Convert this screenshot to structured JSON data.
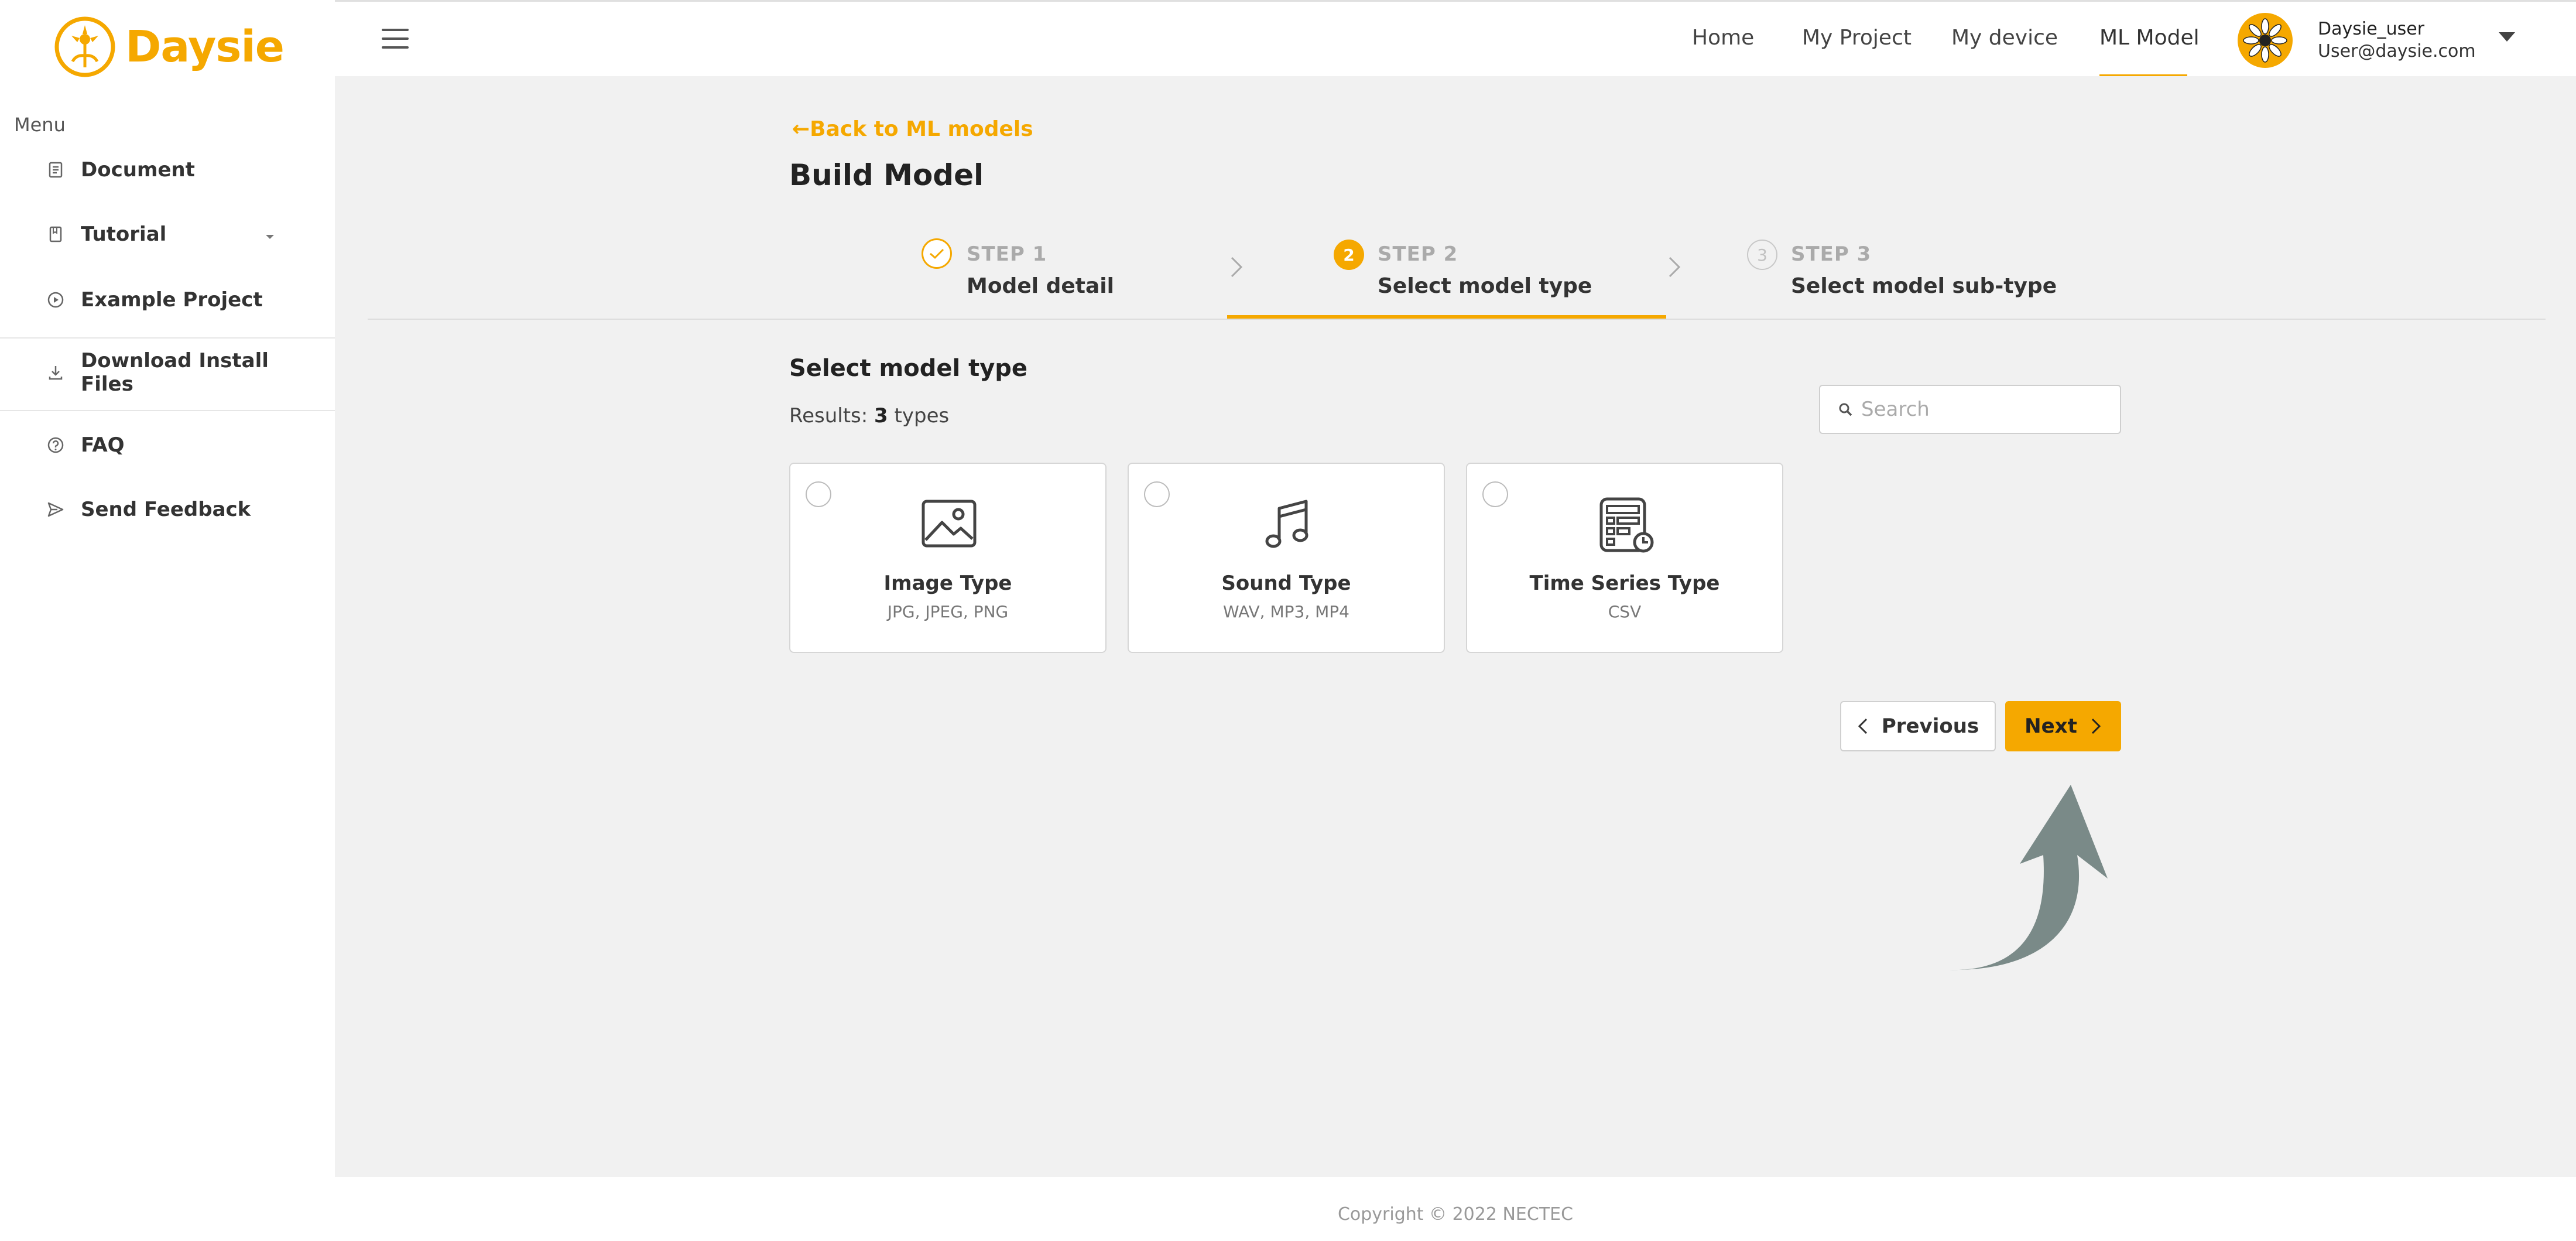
{
  "brand": {
    "name": "Daysie",
    "color": "#f5a800"
  },
  "sidebar": {
    "menu_label": "Menu",
    "items": [
      {
        "label": "Document",
        "icon": "document-icon"
      },
      {
        "label": "Tutorial",
        "icon": "book-icon",
        "has_dropdown": true
      },
      {
        "label": "Example Project",
        "icon": "play-circle-icon"
      },
      {
        "label": "Download Install Files",
        "icon": "download-icon"
      },
      {
        "label": "FAQ",
        "icon": "help-circle-icon"
      },
      {
        "label": "Send Feedback",
        "icon": "send-icon"
      }
    ]
  },
  "topnav": {
    "items": [
      "Home",
      "My Project",
      "My device",
      "ML Model"
    ],
    "active": "ML Model",
    "user": {
      "name": "Daysie_user",
      "email": "User@daysie.com"
    }
  },
  "main": {
    "back_link": "Back to ML models",
    "title": "Build Model",
    "steps": [
      {
        "num_label": "STEP 1",
        "title": "Model detail",
        "state": "done"
      },
      {
        "num_label": "STEP 2",
        "title": "Select model type",
        "state": "active",
        "number": "2"
      },
      {
        "num_label": "STEP 3",
        "title": "Select model sub-type",
        "state": "pending",
        "number": "3"
      }
    ],
    "section_title": "Select model type",
    "results": {
      "prefix": "Results:",
      "count": "3",
      "suffix": "types"
    },
    "search_placeholder": "Search",
    "cards": [
      {
        "title": "Image Type",
        "formats": "JPG, JPEG, PNG",
        "icon": "image-icon"
      },
      {
        "title": "Sound Type",
        "formats": "WAV, MP3, MP4",
        "icon": "music-note-icon"
      },
      {
        "title": "Time Series Type",
        "formats": "CSV",
        "icon": "time-series-icon"
      }
    ],
    "previous_label": "Previous",
    "next_label": "Next"
  },
  "footer": {
    "copyright": "Copyright © 2022 NECTEC"
  }
}
